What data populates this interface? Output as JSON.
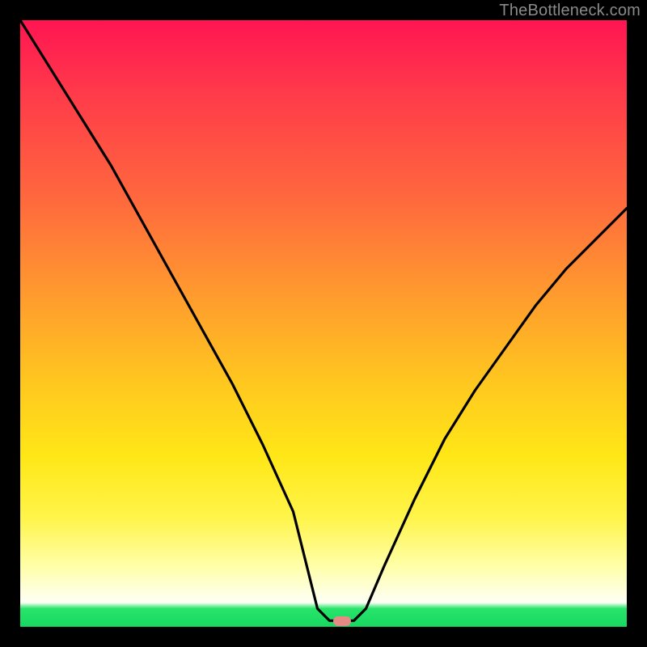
{
  "watermark": "TheBottleneck.com",
  "chart_data": {
    "type": "line",
    "title": "",
    "xlabel": "",
    "ylabel": "",
    "xlim": [
      0,
      100
    ],
    "ylim": [
      0,
      100
    ],
    "grid": false,
    "legend": false,
    "marker": {
      "x": 53,
      "y": 1,
      "color": "#e68a86"
    },
    "series": [
      {
        "name": "curve",
        "color": "#000000",
        "x": [
          0,
          5,
          10,
          15,
          20,
          25,
          30,
          35,
          40,
          45,
          49,
          51,
          55,
          57,
          60,
          65,
          70,
          75,
          80,
          85,
          90,
          95,
          100
        ],
        "y": [
          100,
          92,
          84,
          76,
          67,
          58,
          49,
          40,
          30,
          19,
          3,
          1,
          1,
          3,
          10,
          21,
          31,
          39,
          46,
          53,
          59,
          64,
          69
        ]
      }
    ],
    "background_gradient": {
      "direction": "top-to-bottom",
      "stops": [
        {
          "pos": 0.0,
          "color": "#ff1552"
        },
        {
          "pos": 0.12,
          "color": "#ff3a4a"
        },
        {
          "pos": 0.3,
          "color": "#ff6a3d"
        },
        {
          "pos": 0.45,
          "color": "#ff9a2e"
        },
        {
          "pos": 0.6,
          "color": "#ffc81f"
        },
        {
          "pos": 0.72,
          "color": "#ffe717"
        },
        {
          "pos": 0.82,
          "color": "#fff44a"
        },
        {
          "pos": 0.9,
          "color": "#ffffa8"
        },
        {
          "pos": 0.96,
          "color": "#fdfff5"
        },
        {
          "pos": 0.97,
          "color": "#28e46a"
        },
        {
          "pos": 1.0,
          "color": "#17d861"
        }
      ]
    }
  }
}
